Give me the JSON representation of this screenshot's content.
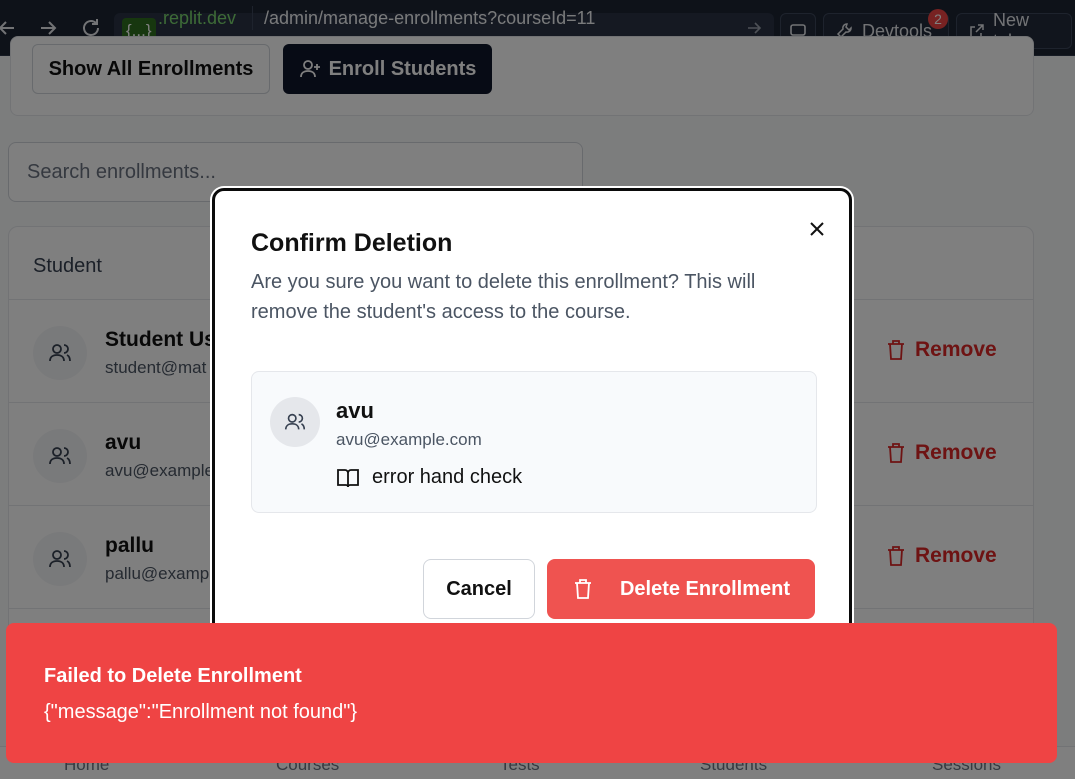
{
  "browser": {
    "url_host_badge": "{...}",
    "url_host": ".replit.dev",
    "url_path": "/admin/manage-enrollments?courseId=11",
    "devtools_label": "Devtools",
    "devtools_badge": "2",
    "new_tab_label": "New tab"
  },
  "page": {
    "show_all_label": "Show All Enrollments",
    "enroll_label": "Enroll Students",
    "search_placeholder": "Search enrollments...",
    "table_header": "Student",
    "rows": [
      {
        "name": "Student Use",
        "email": "student@mat",
        "action": "Remove"
      },
      {
        "name": "avu",
        "email": "avu@example",
        "action": "Remove"
      },
      {
        "name": "pallu",
        "email": "pallu@examp",
        "action": "Remove"
      }
    ],
    "bottom_nav": [
      "Home",
      "Courses",
      "Tests",
      "Students",
      "Sessions"
    ]
  },
  "modal": {
    "title": "Confirm Deletion",
    "description": "Are you sure you want to delete this enrollment? This will remove the student's access to the course.",
    "student_name": "avu",
    "student_email": "avu@example.com",
    "course_name": "error hand check",
    "cancel_label": "Cancel",
    "delete_label": "Delete Enrollment"
  },
  "toast": {
    "title": "Failed to Delete Enrollment",
    "message": "{\"message\":\"Enrollment not found\"}"
  },
  "colors": {
    "danger": "#ef4444",
    "delete_button": "#ef5350",
    "topbar": "#1c2433",
    "url_host": "#7bd66f"
  }
}
